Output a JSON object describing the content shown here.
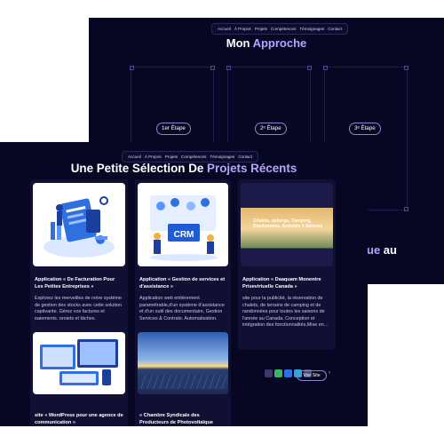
{
  "nav": {
    "items": [
      "Accueil",
      "À Propos",
      "Projets",
      "Compétences",
      "Témoignages",
      "Contact"
    ]
  },
  "back": {
    "title_prefix": "Mon",
    "title_accent": "Approche",
    "steps": [
      "1er Étape",
      "2ᵉ Étape",
      "3ᵉ Étape"
    ],
    "tail_accent": "ue",
    "tail_text": " au"
  },
  "front": {
    "title_prefix": "Une Petite Sélection De",
    "title_accent": "Projets Récents",
    "projects": [
      {
        "title": "Application « De Facturation Pour Les Petites Entreprises »",
        "desc": "Explorez les merveilles de notre système de gestion des stocks avec cette solution captivante. Gérez vos factures et paiements, projets et tâches,"
      },
      {
        "title": "Application « Gestion de services et d'assistance »",
        "desc": "Application web entièrement paramétrable,d'un système d'assistance et d'un outil des documentaire, Gestion Services & Contrats, Automatisation,",
        "thumb_label": "CRM"
      },
      {
        "title": "Application « Daaquam Monentre Prisevirtuelle Canada »",
        "desc": "site pour la publicité, la réservation de chalets, de terrains de camping et de randonnées pour toutes les saisons de l'année au Canada. Conception et intégration des fonctionnalités,Mise en…",
        "thumb_label": "Chalets, auberge, Camping, Randonnées, Activités 4 Saisons",
        "tech_icons": [
          "wordpress-icon",
          "adobe-icon",
          "photoshop-icon",
          "css-icon",
          "react-icon"
        ],
        "button": "Voir Site",
        "arrow": "›"
      },
      {
        "title": "site « WordPress pour une agence de communication »",
        "desc": ""
      },
      {
        "title": "« Chambre Syndicale des Producteurs de Photovoltaïque (CSPV) »",
        "desc": ""
      }
    ]
  },
  "colors": {
    "background": "#080723",
    "card": "#111034",
    "accent": "#b8a3ff",
    "page": "#ffffff"
  }
}
